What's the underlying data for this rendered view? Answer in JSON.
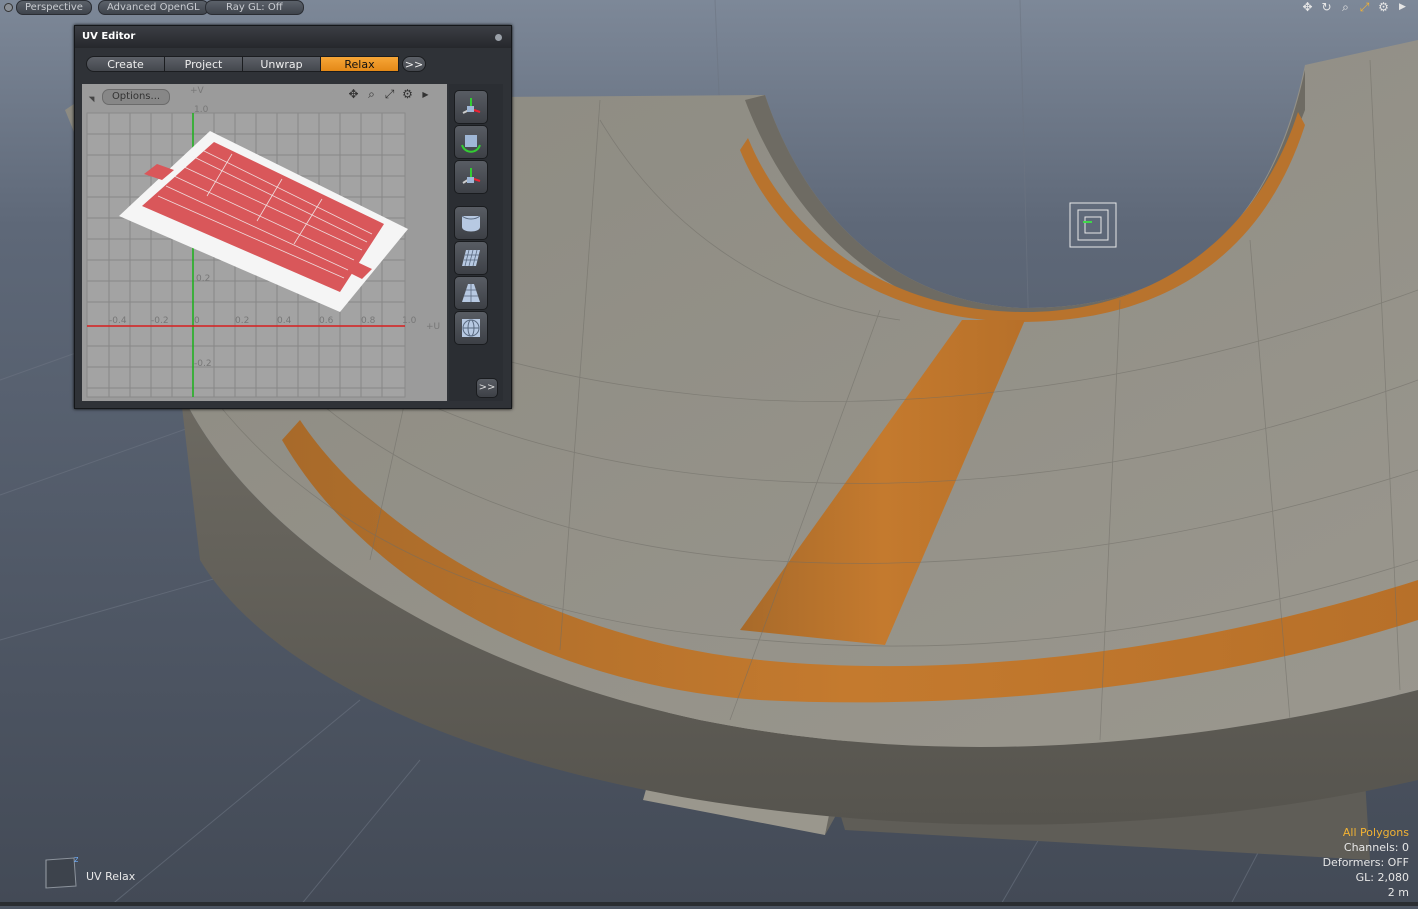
{
  "viewport": {
    "bar_buttons": [
      "Perspective",
      "Advanced OpenGL",
      "Ray GL: Off"
    ],
    "tool_icons": [
      "move-icon",
      "rotate-icon",
      "zoom-icon",
      "maximize-icon",
      "gear-icon",
      "arrow-right-icon"
    ]
  },
  "uv_editor": {
    "title": "UV Editor",
    "tabs": [
      {
        "label": "Create",
        "active": false
      },
      {
        "label": "Project",
        "active": false
      },
      {
        "label": "Unwrap",
        "active": false
      },
      {
        "label": "Relax",
        "active": true
      }
    ],
    "more_label": ">>",
    "options_label": "Options...",
    "toolbar_icons": [
      "move-icon",
      "zoom-icon",
      "fit-icon",
      "gear-icon",
      "arrow-right-icon"
    ],
    "grid": {
      "v_axis_label": "+V",
      "u_axis_label": "+U",
      "v_top_label": "1.0",
      "u_tick_labels": [
        "-0.4",
        "-0.2",
        "0",
        "0.2",
        "0.4",
        "0.6",
        "0.8",
        "1.0"
      ],
      "v_tick_labels": [
        "0.2",
        "-0.2"
      ]
    },
    "right_tools": [
      "transform-gizmo-icon",
      "rotate-cube-icon",
      "uv-transform-icon",
      "cylinder-project-icon",
      "plane-grid-icon",
      "pyramid-icon",
      "sphere-project-icon"
    ],
    "right_more_label": ">>"
  },
  "hud": {
    "tool_name": "UV Relax"
  },
  "status": {
    "selection_mode": "All Polygons",
    "channels": "Channels: 0",
    "deformers": "Deformers: OFF",
    "gl": "GL: 2,080",
    "scale": "2 m"
  },
  "colors": {
    "accent": "#f29a28",
    "uv_mesh": "#d9575a",
    "viewport_bg": "#4e5663"
  }
}
